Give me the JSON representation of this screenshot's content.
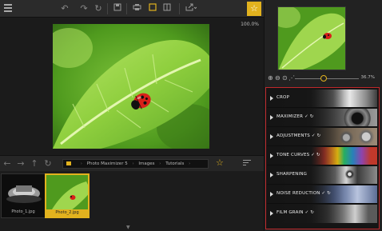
{
  "toolbar": {
    "menu_icon": "hamburger-icon",
    "tools": [
      "undo-icon",
      "redo-icon",
      "redo-all-icon",
      "save-icon",
      "print-icon",
      "single-view-icon",
      "split-view-icon",
      "export-icon"
    ],
    "active_tool": "single-view-icon",
    "favorite_icon": "star-icon"
  },
  "canvas": {
    "zoom": "100.0%"
  },
  "navigation": {
    "breadcrumb": [
      "Photo Maximizer 5",
      "Images",
      "Tutorials"
    ],
    "separator": "›"
  },
  "filmstrip": {
    "items": [
      {
        "label": "Photo_1.jpg",
        "selected": false
      },
      {
        "label": "Photo_2.jpg",
        "selected": true
      }
    ]
  },
  "preview": {
    "zoom_pct": "36.7%"
  },
  "filters": [
    {
      "label": "CROP"
    },
    {
      "label": "MAXIMIZER ✓ ↻"
    },
    {
      "label": "ADJUSTMENTS ✓ ↻"
    },
    {
      "label": "TONE CURVES ✓ ↻"
    },
    {
      "label": "SHARPENING"
    },
    {
      "label": "NOISE REDUCTION ✓ ↻"
    },
    {
      "label": "FILM GRAIN ✓ ↻"
    }
  ],
  "colors": {
    "accent": "#e2b21e",
    "highlight_border": "#c0282b",
    "panel_bg": "#222222"
  }
}
